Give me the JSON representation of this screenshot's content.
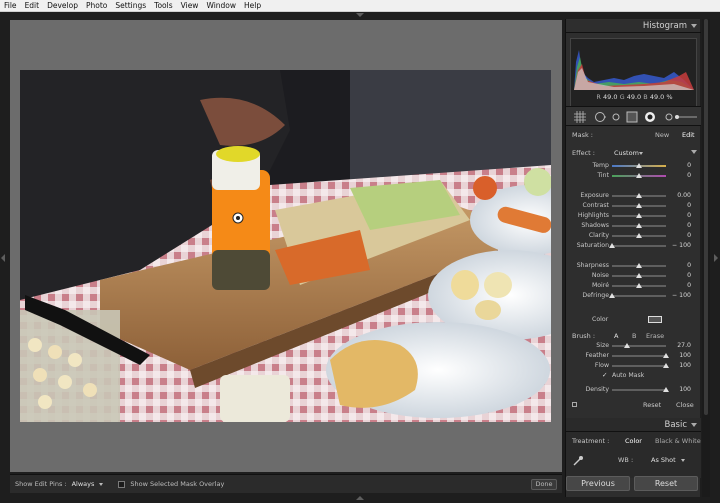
{
  "menu": [
    "File",
    "Edit",
    "Develop",
    "Photo",
    "Settings",
    "Tools",
    "View",
    "Window",
    "Help"
  ],
  "toolbar": {
    "edit_pins_label": "Show Edit Pins :",
    "edit_pins_value": "Always",
    "overlay_label": "Show Selected Mask Overlay",
    "done_label": "Done"
  },
  "histogram": {
    "title": "Histogram",
    "r_label": "R",
    "r_value": "49.0",
    "g_label": "G",
    "g_value": "49.0",
    "b_label": "B",
    "b_value": "49.0",
    "unit": "%"
  },
  "mask": {
    "label": "Mask :",
    "new_label": "New",
    "edit_label": "Edit"
  },
  "effect": {
    "label": "Effect :",
    "value": "Custom"
  },
  "sliders": [
    {
      "label": "Temp",
      "value": "0",
      "pos": 0.5
    },
    {
      "label": "Tint",
      "value": "0",
      "pos": 0.5
    },
    {
      "label": "Exposure",
      "value": "0.00",
      "pos": 0.5
    },
    {
      "label": "Contrast",
      "value": "0",
      "pos": 0.5
    },
    {
      "label": "Highlights",
      "value": "0",
      "pos": 0.5
    },
    {
      "label": "Shadows",
      "value": "0",
      "pos": 0.5
    },
    {
      "label": "Clarity",
      "value": "0",
      "pos": 0.5
    },
    {
      "label": "Saturation",
      "value": "− 100",
      "pos": 0.0
    },
    {
      "label": "Sharpness",
      "value": "0",
      "pos": 0.5
    },
    {
      "label": "Noise",
      "value": "0",
      "pos": 0.5
    },
    {
      "label": "Moiré",
      "value": "0",
      "pos": 0.5
    },
    {
      "label": "Defringe",
      "value": "− 100",
      "pos": 0.0
    }
  ],
  "color_label": "Color",
  "brush": {
    "label": "Brush :",
    "a_label": "A",
    "b_label": "B",
    "erase_label": "Erase",
    "size_label": "Size",
    "size_value": "27.0",
    "size_pos": 0.27,
    "feather_label": "Feather",
    "feather_value": "100",
    "feather_pos": 1.0,
    "flow_label": "Flow",
    "flow_value": "100",
    "flow_pos": 1.0,
    "automask_label": "Auto Mask",
    "density_label": "Density",
    "density_value": "100",
    "density_pos": 1.0,
    "reset_label": "Reset",
    "close_label": "Close"
  },
  "basic": {
    "title": "Basic",
    "treatment_label": "Treatment :",
    "color_label": "Color",
    "bw_label": "Black & White",
    "wb_label": "WB :",
    "wb_value": "As Shot"
  },
  "buttons": {
    "previous": "Previous",
    "reset": "Reset"
  }
}
